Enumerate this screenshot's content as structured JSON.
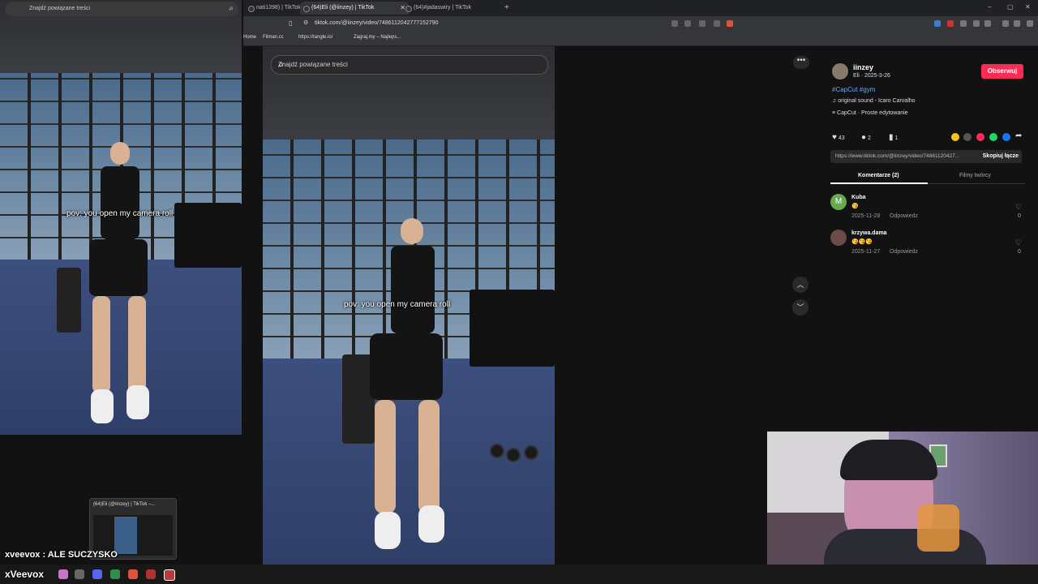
{
  "browser": {
    "tabs": [
      {
        "label": "nati1398) | TikTok",
        "active": false
      },
      {
        "label": "(64)Eli (@iinzey) | TikTok",
        "active": true
      },
      {
        "label": "(64)#jadaswiry | TikTok",
        "active": false
      }
    ],
    "new_tab": "+",
    "url": "tiktok.com/@iinzey/video/7486112042777152790",
    "bookmarks": [
      "Home",
      "Filman.cc",
      "https://tangle.io/",
      "Zagraj.my – Najleps..."
    ]
  },
  "left_window": {
    "search_placeholder": "Znajdź powiązane treści",
    "overlay_text": "pov: you open my camera roll"
  },
  "video": {
    "search_placeholder": "Znajdź powiązane treści",
    "overlay_text": "pov: you open my camera roll"
  },
  "author": {
    "username": "iinzey",
    "subline": "Eli · 2025-3-26",
    "follow_label": "Obserwuj",
    "hashtags": "#CapCut #gym",
    "sound": "original sound - Icaro Carvalho",
    "capcut": "CapCut · Proste edytowanie"
  },
  "actions": {
    "likes": "43",
    "comments": "2",
    "saves": "1"
  },
  "link": {
    "url": "https://www.tiktok.com/@iinzey/video/74861120427...",
    "copy_label": "Skopiuj łącze"
  },
  "panel_tabs": {
    "comments": "Komentarze (2)",
    "creator_videos": "Filmy twórcy"
  },
  "comments": [
    {
      "avatar": "M",
      "user": "Kuba",
      "text": "😘",
      "date": "2025-11-28",
      "reply": "Odpowiedz",
      "likes": "0"
    },
    {
      "avatar": "",
      "user": "krzywa.dama",
      "text": "😘😘😘",
      "date": "2025-11-27",
      "reply": "Odpowiedz",
      "likes": "0"
    }
  ],
  "taskbar": {
    "preview_title": "(64)Eli (@iinzey) | TikTok –..."
  },
  "stream": {
    "chat_line": "xveevox : ALE SUCZYSKO",
    "watermark": "xVeevox"
  },
  "colors": {
    "accent": "#fe2c55",
    "hashtag": "#5fa8ff",
    "background": "#121212"
  }
}
